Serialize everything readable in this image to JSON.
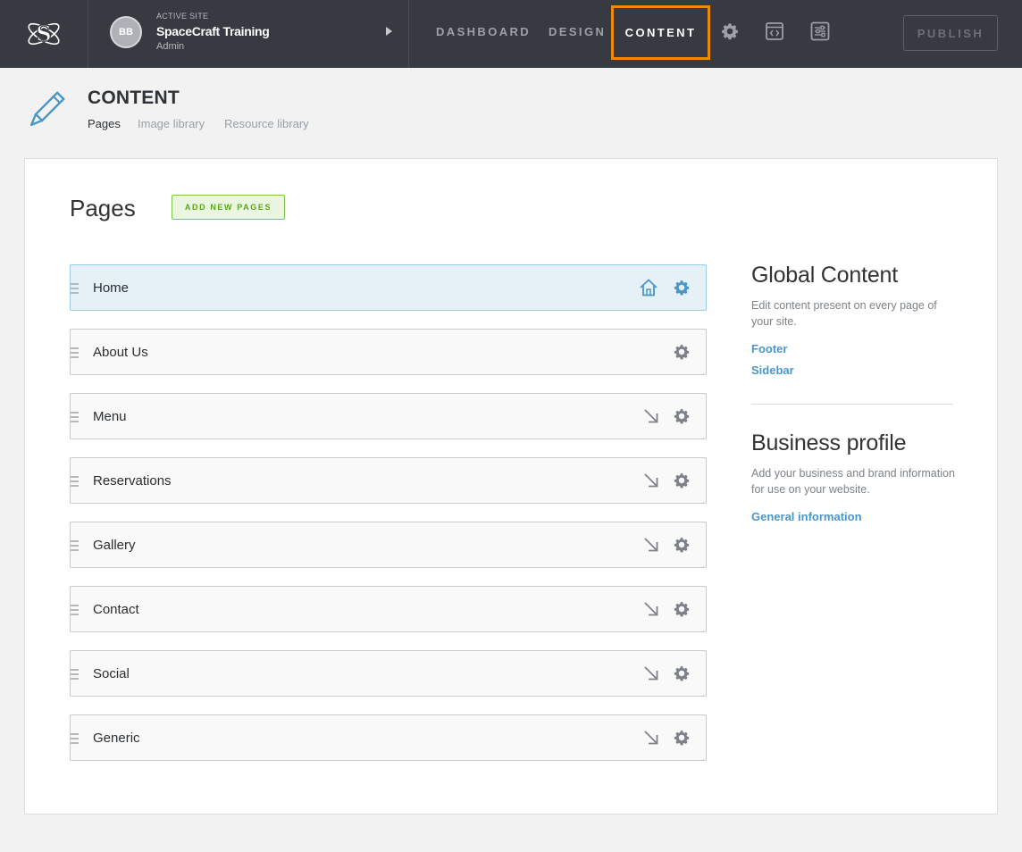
{
  "topbar": {
    "avatar_initials": "BB",
    "site_caption": "ACTIVE SITE",
    "site_name": "SpaceCraft Training",
    "site_role": "Admin",
    "nav": {
      "dashboard": "DASHBOARD",
      "design": "DESIGN",
      "content": "CONTENT"
    },
    "publish_label": "PUBLISH",
    "highlight_color": "#f0880a"
  },
  "header": {
    "title": "CONTENT",
    "tabs": [
      "Pages",
      "Image library",
      "Resource library"
    ],
    "active_tab": "Pages"
  },
  "pages": {
    "heading": "Pages",
    "add_button": "ADD NEW PAGES",
    "items": [
      {
        "label": "Home",
        "is_home": true
      },
      {
        "label": "About Us",
        "is_home": false
      },
      {
        "label": "Menu",
        "is_home": false
      },
      {
        "label": "Reservations",
        "is_home": false
      },
      {
        "label": "Gallery",
        "is_home": false
      },
      {
        "label": "Contact",
        "is_home": false
      },
      {
        "label": "Social",
        "is_home": false
      },
      {
        "label": "Generic",
        "is_home": false
      }
    ]
  },
  "sidebar": {
    "global": {
      "title": "Global Content",
      "description": "Edit content present on every page of your site.",
      "links": [
        "Footer",
        "Sidebar"
      ]
    },
    "business": {
      "title": "Business profile",
      "description": "Add your business and brand information for use on your website.",
      "links": [
        "General information"
      ]
    }
  }
}
